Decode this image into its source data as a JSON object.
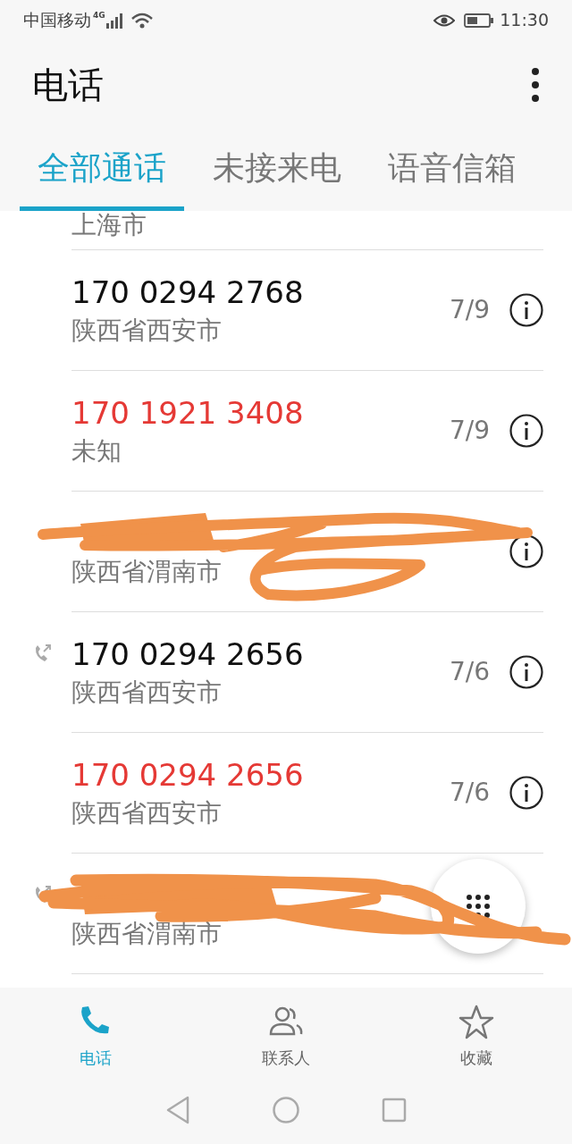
{
  "status_bar": {
    "carrier": "中国移动",
    "network": "4G",
    "time": "11:30"
  },
  "app_bar": {
    "title": "电话"
  },
  "tabs": [
    {
      "label": "全部通话",
      "selected": true
    },
    {
      "label": "未接来电",
      "selected": false
    },
    {
      "label": "语音信箱",
      "selected": false
    }
  ],
  "calls": [
    {
      "location": "上海市",
      "partial": true,
      "outgoing": false,
      "redacted": false
    },
    {
      "number": "170 0294 2768",
      "location": "陕西省西安市",
      "date": "7/9",
      "missed": false,
      "outgoing": false,
      "redacted": false
    },
    {
      "number": "170 1921 3408",
      "location": "未知",
      "date": "7/9",
      "missed": true,
      "outgoing": false,
      "redacted": false
    },
    {
      "location": "陕西省渭南市",
      "partial": false,
      "outgoing": false,
      "redacted": true
    },
    {
      "number": "170 0294 2656",
      "location": "陕西省西安市",
      "date": "7/6",
      "missed": false,
      "outgoing": true,
      "redacted": false
    },
    {
      "number": "170 0294 2656",
      "location": "陕西省西安市",
      "date": "7/6",
      "missed": true,
      "outgoing": false,
      "redacted": false
    },
    {
      "location": "陕西省渭南市",
      "partial": false,
      "outgoing": true,
      "redacted": true,
      "info_covered": true
    }
  ],
  "bottom_nav": [
    {
      "label": "电话",
      "selected": true
    },
    {
      "label": "联系人",
      "selected": false
    },
    {
      "label": "收藏",
      "selected": false
    }
  ]
}
